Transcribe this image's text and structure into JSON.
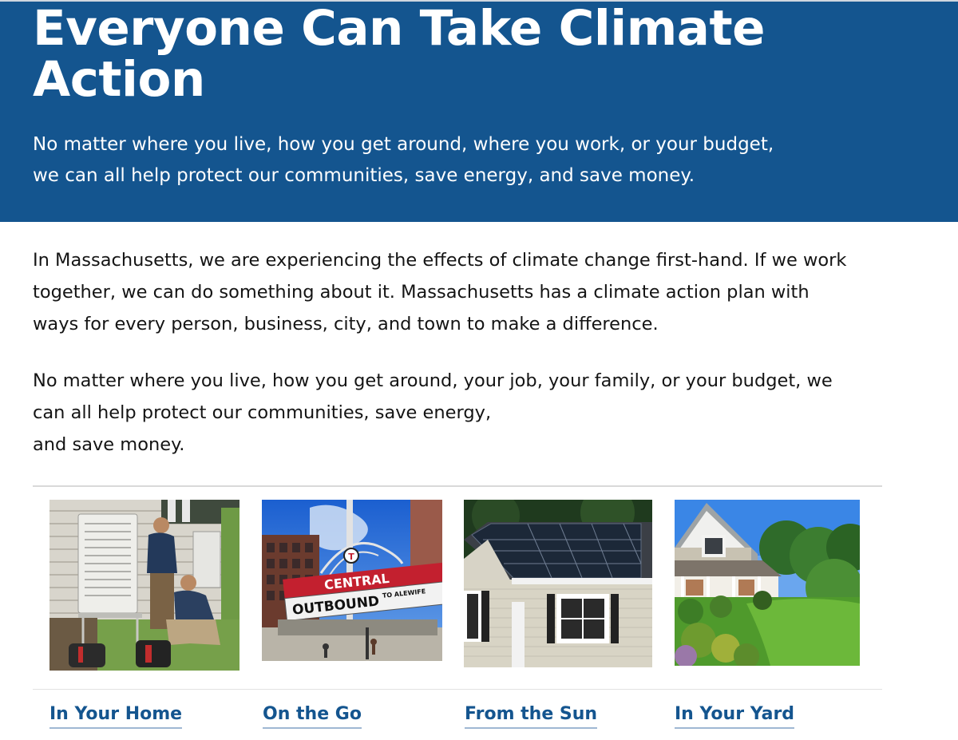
{
  "hero": {
    "title": "Everyone Can Take Climate Action",
    "subtitle_line1": "No matter where you live, how you get around, where you work, or your budget,",
    "subtitle_line2": "we can all help protect our communities, save energy, and save money."
  },
  "intro": {
    "p1_line1": "In Massachusetts, we are experiencing the effects of climate change first-hand. If we work",
    "p1_line2": "together, we can do something about it. Massachusetts has a climate action plan with",
    "p1_line3": "ways for every person, business, city, and town to make a difference.",
    "p2_line1": "No matter where you live, how you get around, your job, your family, or your budget, we",
    "p2_line2": "can all help protect our communities, save energy,",
    "p2_line3": "and save money."
  },
  "cards": [
    {
      "label": "In Your Home"
    },
    {
      "label": "On the Go"
    },
    {
      "label": "From the Sun"
    },
    {
      "label": "In Your Yard"
    }
  ],
  "sign": {
    "top": "CENTRAL",
    "bottom": "OUTBOUND",
    "small": "TO ALEWIFE",
    "symbol": "T"
  },
  "colors": {
    "brand_blue": "#14558f",
    "link_underline": "#9fb8d3"
  }
}
